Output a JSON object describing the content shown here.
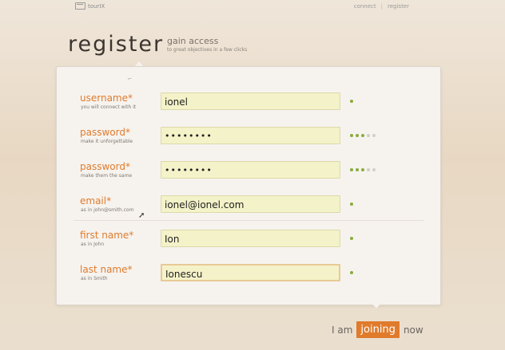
{
  "header": {
    "logo_text": "tourIX",
    "nav": [
      "connect",
      "register"
    ]
  },
  "page": {
    "title": "register",
    "subtitle": "gain access",
    "subtitle_small": "to great objectives in a few clicks"
  },
  "form": {
    "fields": [
      {
        "label": "username*",
        "hint": "you will connect with it",
        "value": "ionel",
        "strength": 1,
        "strength_max": 1
      },
      {
        "label": "password*",
        "hint": "make it unforgettable",
        "value": "••••••••",
        "strength": 3,
        "strength_max": 5
      },
      {
        "label": "password*",
        "hint": "make them the same",
        "value": "••••••••",
        "strength": 3,
        "strength_max": 5
      },
      {
        "label": "email*",
        "hint": "as in john@smith.com",
        "value": "ionel@ionel.com",
        "strength": 1,
        "strength_max": 1
      },
      {
        "label": "first name*",
        "hint": "as in John",
        "value": "Ion",
        "strength": 1,
        "strength_max": 1
      },
      {
        "label": "last name*",
        "hint": "as in Smith",
        "value": "Ionescu",
        "strength": 1,
        "strength_max": 1
      }
    ]
  },
  "footer": {
    "prefix": "I am",
    "button_label": "joining",
    "suffix": "now"
  },
  "colors": {
    "accent": "#e07b2c",
    "valid": "#8aac3a",
    "input_bg": "#f4f2c8"
  }
}
